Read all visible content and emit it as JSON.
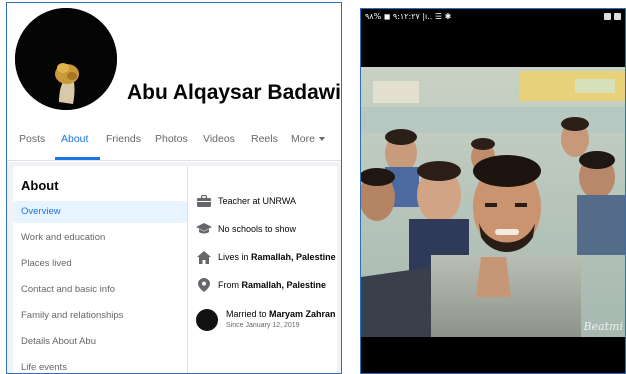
{
  "profile": {
    "name": "Abu Alqaysar Badawi"
  },
  "tabs": [
    {
      "label": "Posts"
    },
    {
      "label": "About"
    },
    {
      "label": "Friends"
    },
    {
      "label": "Photos"
    },
    {
      "label": "Videos"
    },
    {
      "label": "Reels"
    },
    {
      "label": "More"
    }
  ],
  "about": {
    "heading": "About",
    "nav": [
      {
        "label": "Overview"
      },
      {
        "label": "Work and education"
      },
      {
        "label": "Places lived"
      },
      {
        "label": "Contact and basic info"
      },
      {
        "label": "Family and relationships"
      },
      {
        "label": "Details About Abu"
      },
      {
        "label": "Life events"
      }
    ],
    "overview": {
      "work": "Teacher at UNRWA",
      "education": "No schools to show",
      "lives_prefix": "Lives in ",
      "lives_place": "Ramallah, Palestine",
      "from_prefix": "From ",
      "from_place": "Ramallah, Palestine",
      "married_prefix": "Married to ",
      "married_name": "Maryam Zahran",
      "married_since": "Since January 12, 2019"
    }
  },
  "phone": {
    "status_text": "٩:١٢:٢٧ ◼ %٩٨ |ı.. ☰ ✱",
    "watermark": "Beatmi"
  },
  "colors": {
    "accent": "#1b74e4",
    "nav_active_bg": "#e7f3ff",
    "panel_border": "#2e6fb6"
  }
}
